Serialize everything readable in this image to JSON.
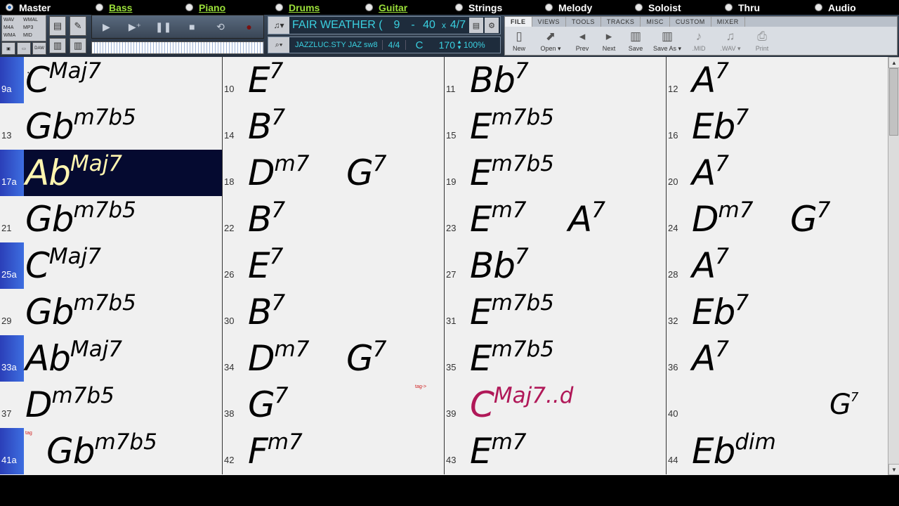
{
  "tracks": [
    {
      "name": "Master",
      "active": true,
      "green": false
    },
    {
      "name": "Bass",
      "active": false,
      "green": true
    },
    {
      "name": "Piano",
      "active": false,
      "green": true
    },
    {
      "name": "Drums",
      "active": false,
      "green": true
    },
    {
      "name": "Guitar",
      "active": false,
      "green": true
    },
    {
      "name": "Strings",
      "active": false,
      "green": false
    },
    {
      "name": "Melody",
      "active": false,
      "green": false
    },
    {
      "name": "Soloist",
      "active": false,
      "green": false
    },
    {
      "name": "Thru",
      "active": false,
      "green": false
    },
    {
      "name": "Audio",
      "active": false,
      "green": false
    }
  ],
  "format_box": {
    "wav": "WAV",
    "wmal": "WMAL",
    "m4a": "M4A",
    "plus": "+",
    "mp3": "MP3",
    "wma": "WMA",
    "mid": "MID",
    "daw": "DAW"
  },
  "song": {
    "title": "FAIR WEATHER (",
    "bar_start": "9",
    "dash": "-",
    "bar_end": "40",
    "x": "x",
    "loop_count": "4/7",
    "style": "JAZZLUC.STY JAZ",
    "feel": "sw8",
    "time_sig": "4/4",
    "key": "C",
    "tempo": "170",
    "tempo_pct": "100%"
  },
  "ribbon": {
    "tabs": [
      "FILE",
      "VIEWS",
      "TOOLS",
      "TRACKS",
      "MISC",
      "CUSTOM",
      "MIXER"
    ],
    "buttons": [
      {
        "label": "New",
        "icon": "new-file-icon"
      },
      {
        "label": "Open ▾",
        "icon": "open-icon"
      },
      {
        "label": "Prev",
        "icon": "prev-icon"
      },
      {
        "label": "Next",
        "icon": "next-icon"
      },
      {
        "label": "Save",
        "icon": "save-icon"
      },
      {
        "label": "Save As ▾",
        "icon": "save-as-icon"
      },
      {
        "label": ".MID",
        "icon": "midi-icon"
      },
      {
        "label": ".WAV ▾",
        "icon": "wav-icon"
      },
      {
        "label": "Print",
        "icon": "print-icon"
      }
    ]
  },
  "sheet": {
    "rows": [
      {
        "cells": [
          {
            "bar": "9a",
            "section": true,
            "chords": [
              {
                "root": "C",
                "ext": "Maj7"
              }
            ]
          },
          {
            "bar": "10",
            "chords": [
              {
                "root": "E",
                "ext": "7"
              }
            ]
          },
          {
            "bar": "11",
            "chords": [
              {
                "root": "Bb",
                "ext": "7"
              }
            ]
          },
          {
            "bar": "12",
            "chords": [
              {
                "root": "A",
                "ext": "7"
              }
            ]
          }
        ]
      },
      {
        "cells": [
          {
            "bar": "13",
            "chords": [
              {
                "root": "Gb",
                "ext": "m7b5"
              }
            ]
          },
          {
            "bar": "14",
            "chords": [
              {
                "root": "B",
                "ext": "7"
              }
            ]
          },
          {
            "bar": "15",
            "chords": [
              {
                "root": "E",
                "ext": "m7b5"
              }
            ]
          },
          {
            "bar": "16",
            "chords": [
              {
                "root": "Eb",
                "ext": "7"
              }
            ]
          }
        ]
      },
      {
        "cells": [
          {
            "bar": "17a",
            "section": true,
            "highlight": true,
            "chords": [
              {
                "root": "Ab",
                "ext": "Maj7"
              }
            ]
          },
          {
            "bar": "18",
            "chords": [
              {
                "root": "D",
                "ext": "m7"
              },
              {
                "root": "G",
                "ext": "7"
              }
            ]
          },
          {
            "bar": "19",
            "chords": [
              {
                "root": "E",
                "ext": "m7b5"
              }
            ]
          },
          {
            "bar": "20",
            "chords": [
              {
                "root": "A",
                "ext": "7"
              }
            ]
          }
        ]
      },
      {
        "cells": [
          {
            "bar": "21",
            "chords": [
              {
                "root": "Gb",
                "ext": "m7b5"
              }
            ]
          },
          {
            "bar": "22",
            "chords": [
              {
                "root": "B",
                "ext": "7"
              }
            ]
          },
          {
            "bar": "23",
            "chords": [
              {
                "root": "E",
                "ext": "m7"
              },
              {
                "root": "A",
                "ext": "7"
              }
            ]
          },
          {
            "bar": "24",
            "chords": [
              {
                "root": "D",
                "ext": "m7"
              },
              {
                "root": "G",
                "ext": "7"
              }
            ]
          }
        ]
      },
      {
        "cells": [
          {
            "bar": "25a",
            "section": true,
            "chords": [
              {
                "root": "C",
                "ext": "Maj7"
              }
            ]
          },
          {
            "bar": "26",
            "chords": [
              {
                "root": "E",
                "ext": "7"
              }
            ]
          },
          {
            "bar": "27",
            "chords": [
              {
                "root": "Bb",
                "ext": "7"
              }
            ]
          },
          {
            "bar": "28",
            "chords": [
              {
                "root": "A",
                "ext": "7"
              }
            ]
          }
        ]
      },
      {
        "cells": [
          {
            "bar": "29",
            "chords": [
              {
                "root": "Gb",
                "ext": "m7b5"
              }
            ]
          },
          {
            "bar": "30",
            "chords": [
              {
                "root": "B",
                "ext": "7"
              }
            ]
          },
          {
            "bar": "31",
            "chords": [
              {
                "root": "E",
                "ext": "m7b5"
              }
            ]
          },
          {
            "bar": "32",
            "chords": [
              {
                "root": "Eb",
                "ext": "7"
              }
            ]
          }
        ]
      },
      {
        "cells": [
          {
            "bar": "33a",
            "section": true,
            "chords": [
              {
                "root": "Ab",
                "ext": "Maj7"
              }
            ]
          },
          {
            "bar": "34",
            "chords": [
              {
                "root": "D",
                "ext": "m7"
              },
              {
                "root": "G",
                "ext": "7"
              }
            ]
          },
          {
            "bar": "35",
            "chords": [
              {
                "root": "E",
                "ext": "m7b5"
              }
            ]
          },
          {
            "bar": "36",
            "chords": [
              {
                "root": "A",
                "ext": "7"
              }
            ]
          }
        ]
      },
      {
        "cells": [
          {
            "bar": "37",
            "chords": [
              {
                "root": "D",
                "ext": "m7b5"
              }
            ]
          },
          {
            "bar": "38",
            "chords": [
              {
                "root": "G",
                "ext": "7"
              }
            ]
          },
          {
            "bar": "39",
            "tag": "tag->",
            "chords": [
              {
                "root": "C",
                "ext": "Maj7..d",
                "red": true
              }
            ]
          },
          {
            "bar": "40",
            "chords": [
              {
                "root": "G",
                "ext": "7",
                "small": true
              }
            ]
          }
        ]
      },
      {
        "cells": [
          {
            "bar": "41a",
            "section": true,
            "tag": "tag",
            "chords": [
              {
                "root": "Gb",
                "ext": "m7b5"
              }
            ]
          },
          {
            "bar": "42",
            "chords": [
              {
                "root": "F",
                "ext": "m7"
              }
            ]
          },
          {
            "bar": "43",
            "chords": [
              {
                "root": "E",
                "ext": "m7"
              }
            ]
          },
          {
            "bar": "44",
            "chords": [
              {
                "root": "Eb",
                "ext": "dim"
              }
            ]
          }
        ]
      }
    ]
  },
  "scrollbar": {
    "thumb_position": 0.0,
    "thumb_fraction": 0.17
  }
}
